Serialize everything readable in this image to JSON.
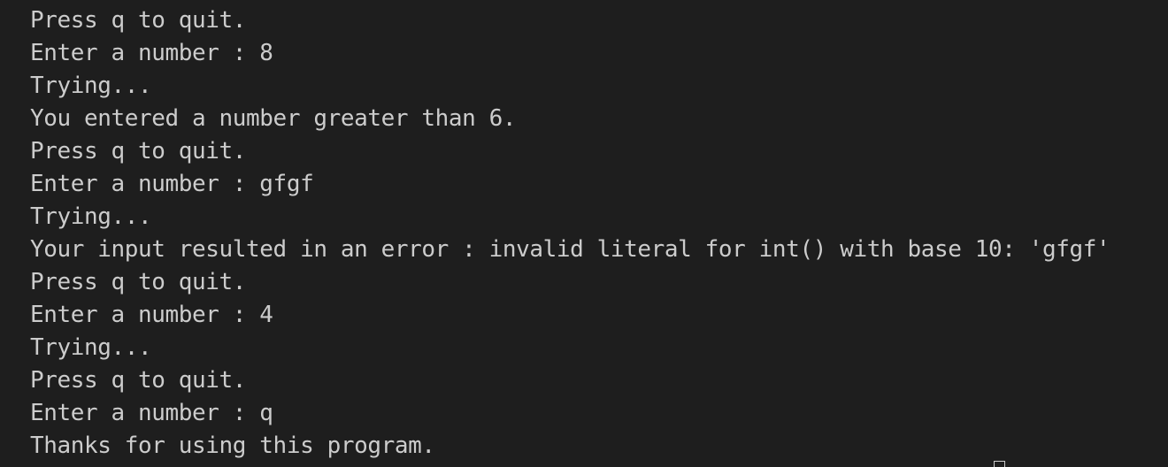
{
  "terminal": {
    "lines": [
      "Press q to quit.",
      "Enter a number : 8",
      "Trying...",
      "You entered a number greater than 6.",
      "Press q to quit.",
      "Enter a number : gfgf",
      "Trying...",
      "Your input resulted in an error : invalid literal for int() with base 10: 'gfgf'",
      "Press q to quit.",
      "Enter a number : 4",
      "Trying...",
      "Press q to quit.",
      "Enter a number : q",
      "Thanks for using this program."
    ]
  },
  "colors": {
    "background": "#1e1e1e",
    "foreground": "#cccccc"
  }
}
